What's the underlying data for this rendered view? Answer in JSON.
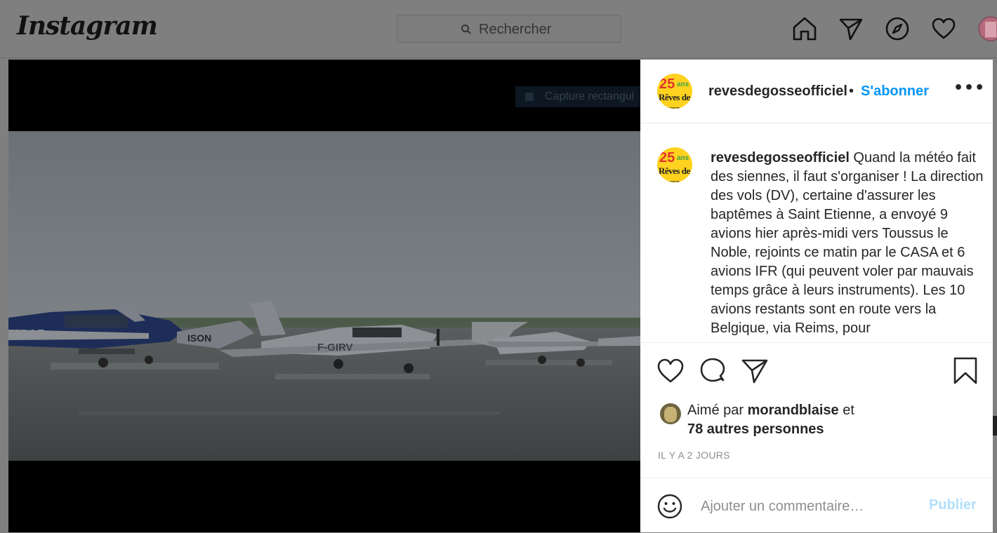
{
  "header": {
    "logo_text": "Instagram",
    "search_placeholder": "Rechercher",
    "nav_icons": [
      "home-icon",
      "direct-icon",
      "explore-icon",
      "activity-heart-icon",
      "profile-avatar"
    ]
  },
  "media": {
    "overlay_text": "Capture rectangul",
    "photo_subject": "aircraft on wet apron",
    "registrations": [
      "F-GIRV",
      "HCAP",
      "ISON"
    ]
  },
  "post": {
    "username": "revesdegosseofficiel",
    "separator": "•",
    "follow_label": "S'abonner",
    "more_label": "•••",
    "caption_username": "revesdegosseofficiel",
    "caption_text": " Quand la météo fait des siennes, il faut s'organiser ! La direction des vols (DV), certaine d'assurer les baptêmes à Saint Etienne, a envoyé 9 avions hier après-midi vers Toussus le Noble, rejoints ce matin par le CASA et 6 avions IFR (qui peuvent voler par mauvais temps grâce à leurs instruments). Les 10 avions restants sont en route vers la Belgique, via Reims, pour",
    "avatar_number": "25",
    "avatar_ans": "ans",
    "avatar_text": "Rêves de Gosse",
    "likes_prefix": "Aimé par ",
    "liked_by": "morandblaise",
    "likes_middle": " et",
    "likes_others": "78 autres personnes",
    "timestamp": "IL Y A 2 JOURS",
    "comment_placeholder": "Ajouter un commentaire…",
    "publish_label": "Publier"
  },
  "colors": {
    "overlay_dim": "#7f7f7f",
    "link_blue": "#0095f6",
    "publish_disabled": "#b2dffc",
    "text": "#262626",
    "muted": "#8e8e8e"
  }
}
